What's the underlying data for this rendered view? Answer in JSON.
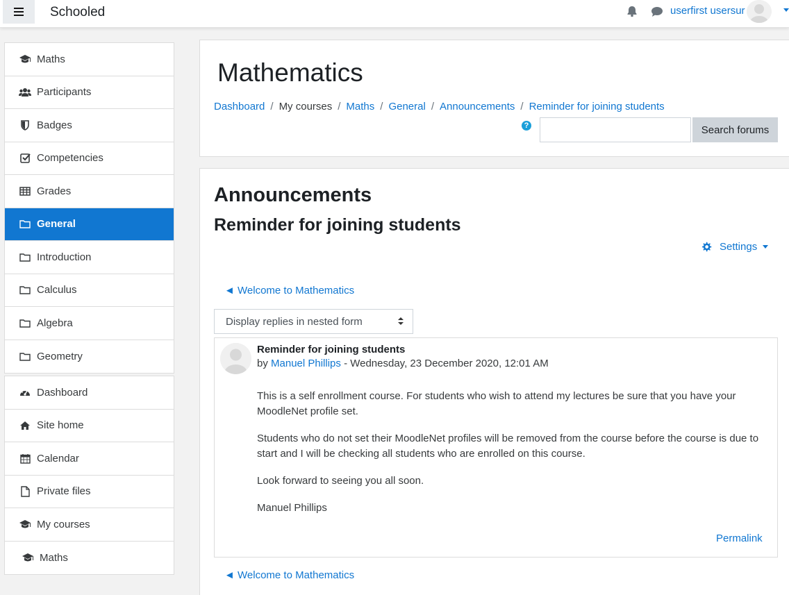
{
  "navbar": {
    "brand": "Schooled",
    "user_name": "userfirst usersur"
  },
  "drawer": {
    "course_items": [
      {
        "label": "Maths",
        "icon": "graduation-cap-icon"
      },
      {
        "label": "Participants",
        "icon": "users-icon"
      },
      {
        "label": "Badges",
        "icon": "shield-icon"
      },
      {
        "label": "Competencies",
        "icon": "check-square-icon"
      },
      {
        "label": "Grades",
        "icon": "table-icon"
      },
      {
        "label": "General",
        "icon": "folder-icon",
        "active": true
      },
      {
        "label": "Introduction",
        "icon": "folder-icon"
      },
      {
        "label": "Calculus",
        "icon": "folder-icon"
      },
      {
        "label": "Algebra",
        "icon": "folder-icon"
      },
      {
        "label": "Geometry",
        "icon": "folder-icon"
      }
    ],
    "site_items": [
      {
        "label": "Dashboard",
        "icon": "tachometer-icon"
      },
      {
        "label": "Site home",
        "icon": "home-icon"
      },
      {
        "label": "Calendar",
        "icon": "calendar-icon"
      },
      {
        "label": "Private files",
        "icon": "file-icon"
      },
      {
        "label": "My courses",
        "icon": "graduation-cap-icon"
      },
      {
        "label": "Maths",
        "icon": "graduation-cap-icon"
      }
    ]
  },
  "header": {
    "title": "Mathematics",
    "breadcrumb": [
      "Dashboard",
      "My courses",
      "Maths",
      "General",
      "Announcements",
      "Reminder for joining students"
    ],
    "help_icon": "?",
    "search_placeholder": "",
    "search_button": "Search forums"
  },
  "forum": {
    "heading": "Announcements",
    "discussion_title": "Reminder for joining students",
    "settings_label": "Settings",
    "prev_link": "◄ Welcome to Mathematics",
    "next_link": "◄ Welcome to Mathematics",
    "display_mode": "Display replies in nested form"
  },
  "post": {
    "subject": "Reminder for joining students",
    "by_prefix": "by ",
    "author": "Manuel Phillips",
    "date": " - Wednesday, 23 December 2020, 12:01 AM",
    "paragraphs": [
      "This is a self enrollment course. For students who wish to attend my lectures be sure that you have your MoodleNet profile set.",
      "Students who do not set their MoodleNet profiles will be  removed from the course before the course is due to start and I will be checking all students who are enrolled on this course.",
      "Look forward to seeing you all soon.",
      "Manuel Phillips"
    ],
    "permalink": "Permalink"
  },
  "colors": {
    "accent": "#1177d1",
    "active_bg": "#1177d1",
    "button_bg": "#ced4da"
  }
}
